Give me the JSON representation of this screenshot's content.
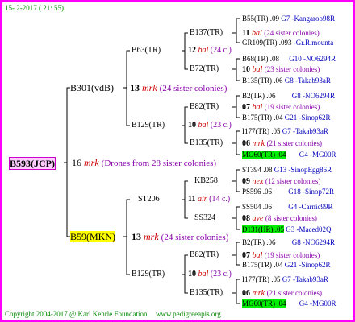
{
  "header": {
    "date": "15-  2-2017 ( 21: 55)"
  },
  "footer": {
    "copyright": "Copyright 2004-2017 @ Karl Kehrle Foundation.",
    "site": "www.pedigreeapis.org"
  },
  "root": {
    "id": "B593(JCP)",
    "num": "16",
    "mark": "mrk",
    "note": "(Drones from 28 sister colonies)"
  },
  "gen1": {
    "sire": {
      "id": "B301(vdB)",
      "num": "13",
      "mark": "mrk",
      "note": "(24 sister colonies)"
    },
    "dam": {
      "id": "B59(MKN)",
      "num": "13",
      "mark": "mrk",
      "note": "(24 sister colonies)"
    }
  },
  "gen2": {
    "s_sire": {
      "id": "B63(TR)",
      "num": "12",
      "mark": "bal",
      "note": "(24 c.)"
    },
    "s_dam": {
      "id": "B129(TR)",
      "num": "10",
      "mark": "bal",
      "note": "(23 c.)"
    },
    "d_sire": {
      "id": "ST206",
      "num": "11",
      "mark": "alr",
      "note": "(14 c.)"
    },
    "d_dam": {
      "id": "B129(TR)",
      "num": "10",
      "mark": "bal",
      "note": "(23 c.)"
    }
  },
  "gen3": [
    {
      "id": "B137(TR)",
      "num": "11",
      "mark": "bal",
      "note": "(24 sister colonies)"
    },
    {
      "id": "B72(TR)",
      "num": "10",
      "mark": "bal",
      "note": "(23 sister colonies)"
    },
    {
      "id": "B82(TR)",
      "num": "07",
      "mark": "bal",
      "note": "(19 sister colonies)"
    },
    {
      "id": "B135(TR)",
      "num": "06",
      "mark": "mrk",
      "note": "(21 sister colonies)"
    },
    {
      "id": "KB258",
      "num": "09",
      "mark": "nex",
      "note": "(12 sister colonies)"
    },
    {
      "id": "SS324",
      "num": "08",
      "mark": "ave",
      "note": "(8 sister colonies)"
    },
    {
      "id": "B82(TR)",
      "num": "07",
      "mark": "bal",
      "note": "(19 sister colonies)"
    },
    {
      "id": "B135(TR)",
      "num": "06",
      "mark": "mrk",
      "note": "(21 sister colonies)"
    }
  ],
  "gen4": [
    {
      "id": "B55(TR)",
      "yr": ".09",
      "ref": "G7 -Kangaroo98R"
    },
    {
      "id": "GR109(TR)",
      "yr": ".093",
      "ref": "-Gr.R.mounta"
    },
    {
      "id": "B68(TR)",
      "yr": ".08",
      "ref": "G10 -NO6294R"
    },
    {
      "id": "B135(TR)",
      "yr": ".06",
      "ref": "G8 -Takab93aR"
    },
    {
      "id": "B2(TR)",
      "yr": ".06",
      "ref": "G8 -NO6294R"
    },
    {
      "id": "B175(TR)",
      "yr": ".04",
      "ref": "G21 -Sinop62R"
    },
    {
      "id": "I177(TR)",
      "yr": ".05",
      "ref": "G7 -Takab93aR"
    },
    {
      "id": "MG60(TR)",
      "yr": ".04",
      "ref": "G4 -MG00R"
    },
    {
      "id": "ST394",
      "yr": ".08",
      "ref": "G13 -SinopEgg86R"
    },
    {
      "id": "PS596",
      "yr": ".06",
      "ref": "G18 -Sinop72R"
    },
    {
      "id": "SS504",
      "yr": ".06",
      "ref": "G4 -Carnic99R"
    },
    {
      "id": "D131(HR)",
      "yr": ".05",
      "ref": "G3 -Maced02Q"
    },
    {
      "id": "B2(TR)",
      "yr": ".06",
      "ref": "G8 -NO6294R"
    },
    {
      "id": "B175(TR)",
      "yr": ".04",
      "ref": "G21 -Sinop62R"
    },
    {
      "id": "I177(TR)",
      "yr": ".05",
      "ref": "G7 -Takab93aR"
    },
    {
      "id": "MG60(TR)",
      "yr": ".04",
      "ref": "G4 -MG00R"
    }
  ],
  "colors": {
    "frame": "#ff00ff",
    "highlight_green": "#00ee00",
    "highlight_yellow": "#ffff00",
    "root_box": "#ffccff"
  }
}
